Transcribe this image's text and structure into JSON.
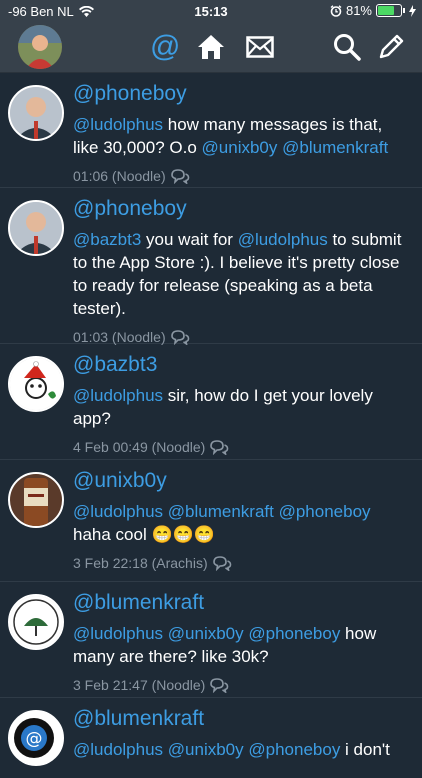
{
  "status": {
    "carrier": "-96 Ben NL",
    "time": "15:13",
    "battery": "81%",
    "battery_level": 0.81
  },
  "navbar": {
    "icons": [
      "avatar",
      "at-icon",
      "home-icon",
      "mail-icon",
      "search-icon",
      "compose-icon"
    ],
    "at_symbol": "@"
  },
  "tweets": [
    {
      "handle": "@phoneboy",
      "parts": [
        {
          "t": "@ludolphus",
          "m": true
        },
        {
          "t": " how many messages is that, like 30,000? O.o ",
          "m": false
        },
        {
          "t": "@unixb0y",
          "m": true
        },
        {
          "t": " ",
          "m": false
        },
        {
          "t": "@blumenkraft",
          "m": true
        }
      ],
      "meta": "01:06 (Noodle)"
    },
    {
      "handle": "@phoneboy",
      "parts": [
        {
          "t": "@bazbt3",
          "m": true
        },
        {
          "t": " you wait for ",
          "m": false
        },
        {
          "t": "@ludolphus",
          "m": true
        },
        {
          "t": " to submit to the App Store :). I believe it's pretty close to ready for release (speaking as a beta tester).",
          "m": false
        }
      ],
      "meta": "01:03 (Noodle)"
    },
    {
      "handle": "@bazbt3",
      "parts": [
        {
          "t": "@ludolphus",
          "m": true
        },
        {
          "t": " sir, how do I get your lovely app?",
          "m": false
        }
      ],
      "meta": "4 Feb 00:49 (Noodle)"
    },
    {
      "handle": "@unixb0y",
      "parts": [
        {
          "t": "@ludolphus",
          "m": true
        },
        {
          "t": " ",
          "m": false
        },
        {
          "t": "@blumenkraft",
          "m": true
        },
        {
          "t": " ",
          "m": false
        },
        {
          "t": "@phoneboy",
          "m": true
        },
        {
          "t": " haha cool 😁😁😁",
          "m": false
        }
      ],
      "meta": "3 Feb 22:18 (Arachis)"
    },
    {
      "handle": "@blumenkraft",
      "parts": [
        {
          "t": "@ludolphus",
          "m": true
        },
        {
          "t": " ",
          "m": false
        },
        {
          "t": "@unixb0y",
          "m": true
        },
        {
          "t": " ",
          "m": false
        },
        {
          "t": "@phoneboy",
          "m": true
        },
        {
          "t": " how many are there? like 30k?",
          "m": false
        }
      ],
      "meta": "3 Feb 21:47 (Noodle)"
    },
    {
      "handle": "@blumenkraft",
      "parts": [
        {
          "t": "@ludolphus",
          "m": true
        },
        {
          "t": " ",
          "m": false
        },
        {
          "t": "@unixb0y",
          "m": true
        },
        {
          "t": " ",
          "m": false
        },
        {
          "t": "@phoneboy",
          "m": true
        },
        {
          "t": " i don't",
          "m": false
        }
      ],
      "meta": ""
    }
  ],
  "colors": {
    "background": "#1e2a36",
    "bar": "#37414b",
    "accent": "#3d9de3",
    "meta": "#8a96a2"
  }
}
